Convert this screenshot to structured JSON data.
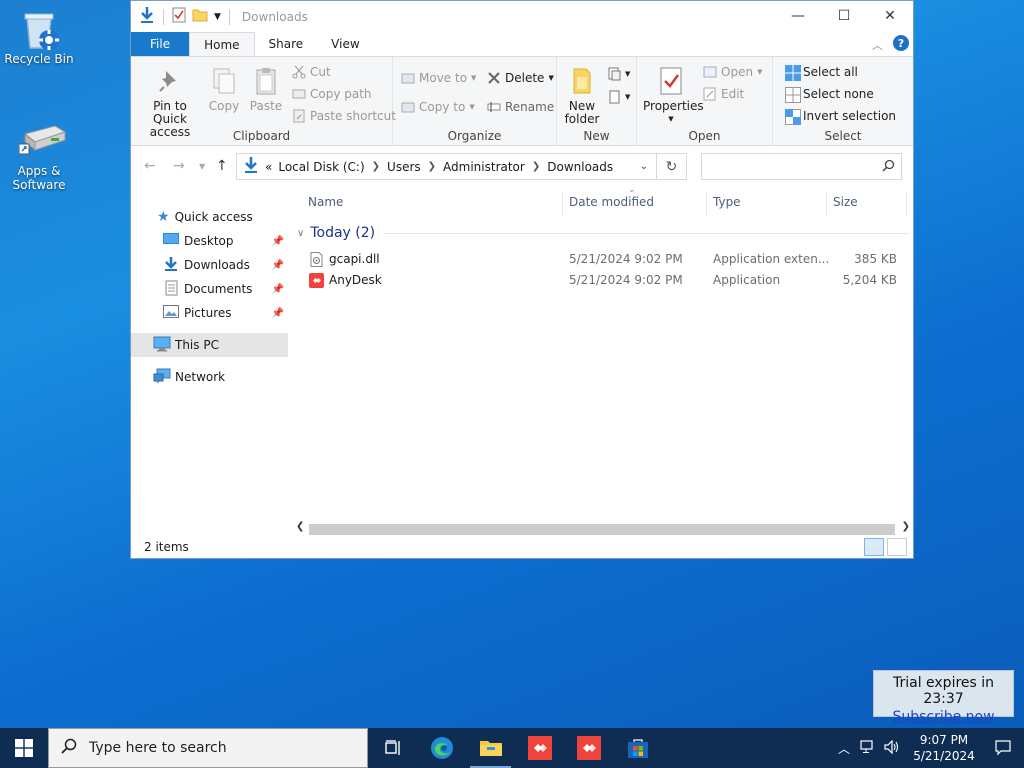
{
  "desktop": {
    "icons": [
      {
        "label": "Recycle Bin"
      },
      {
        "label": "Apps & Software"
      }
    ]
  },
  "window": {
    "title": "Downloads",
    "tabs": [
      "File",
      "Home",
      "Share",
      "View"
    ],
    "active_tab": "Home",
    "ribbon": {
      "clipboard": {
        "label": "Clipboard",
        "pin": "Pin to Quick access",
        "copy": "Copy",
        "paste": "Paste",
        "cut": "Cut",
        "copy_path": "Copy path",
        "paste_shortcut": "Paste shortcut"
      },
      "organize": {
        "label": "Organize",
        "move_to": "Move to",
        "copy_to": "Copy to",
        "delete": "Delete",
        "rename": "Rename"
      },
      "new": {
        "label": "New",
        "new_folder": "New folder"
      },
      "open": {
        "label": "Open",
        "properties": "Properties",
        "open": "Open",
        "edit": "Edit"
      },
      "select": {
        "label": "Select",
        "select_all": "Select all",
        "select_none": "Select none",
        "invert": "Invert selection"
      }
    },
    "address": {
      "crumbs": [
        "Local Disk (C:)",
        "Users",
        "Administrator",
        "Downloads"
      ],
      "overflow": "«",
      "search_placeholder": ""
    },
    "nav": {
      "quick_access": "Quick access",
      "desktop": "Desktop",
      "downloads": "Downloads",
      "documents": "Documents",
      "pictures": "Pictures",
      "this_pc": "This PC",
      "network": "Network"
    },
    "columns": {
      "name": "Name",
      "date": "Date modified",
      "type": "Type",
      "size": "Size"
    },
    "group_header": "Today (2)",
    "files": [
      {
        "name": "gcapi.dll",
        "date": "5/21/2024 9:02 PM",
        "type": "Application exten...",
        "size": "385 KB",
        "icon": "dll-file-icon"
      },
      {
        "name": "AnyDesk",
        "date": "5/21/2024 9:02 PM",
        "type": "Application",
        "size": "5,204 KB",
        "icon": "anydesk-icon"
      }
    ],
    "status": "2 items"
  },
  "trial": {
    "text": "Trial expires in 23:37",
    "link": "Subscribe now"
  },
  "taskbar": {
    "search_placeholder": "Type here to search",
    "time": "9:07 PM",
    "date": "5/21/2024"
  },
  "colors": {
    "accent": "#1979ca",
    "taskbar": "#0f2c53",
    "anydesk": "#ef443b"
  }
}
